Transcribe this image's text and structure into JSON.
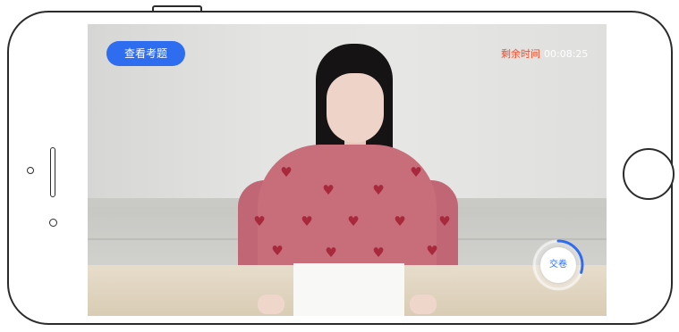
{
  "exam": {
    "view_questions_label": "查看考题",
    "timer_label": "剩余时间",
    "timer_value": "00:08:25",
    "submit_label": "交卷",
    "submit_progress_fraction": 0.3
  },
  "colors": {
    "accent_blue": "#2e6cf0",
    "timer_red": "#f04b2a",
    "device_outline": "#2b2b2b"
  },
  "icons": {
    "home_button": "home-button-icon",
    "camera": "camera-icon"
  }
}
